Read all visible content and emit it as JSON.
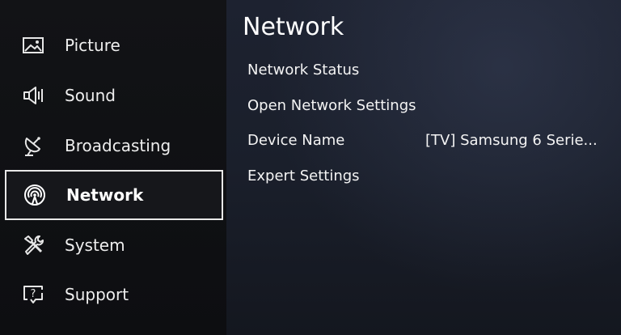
{
  "sidebar": {
    "items": [
      {
        "label": "Picture",
        "icon": "picture-icon"
      },
      {
        "label": "Sound",
        "icon": "speaker-icon"
      },
      {
        "label": "Broadcasting",
        "icon": "satellite-dish-icon"
      },
      {
        "label": "Network",
        "icon": "network-icon",
        "selected": true
      },
      {
        "label": "System",
        "icon": "tools-icon"
      },
      {
        "label": "Support",
        "icon": "help-icon"
      }
    ]
  },
  "panel": {
    "title": "Network",
    "items": [
      {
        "label": "Network Status"
      },
      {
        "label": "Open Network Settings"
      },
      {
        "label": "Device Name",
        "value": "[TV] Samsung 6 Serie..."
      },
      {
        "label": "Expert Settings"
      }
    ]
  },
  "colors": {
    "background": "#0c0e13",
    "panel": "#1d2230",
    "selection_border": "#e8e8e8",
    "text": "#f2f2f2"
  }
}
